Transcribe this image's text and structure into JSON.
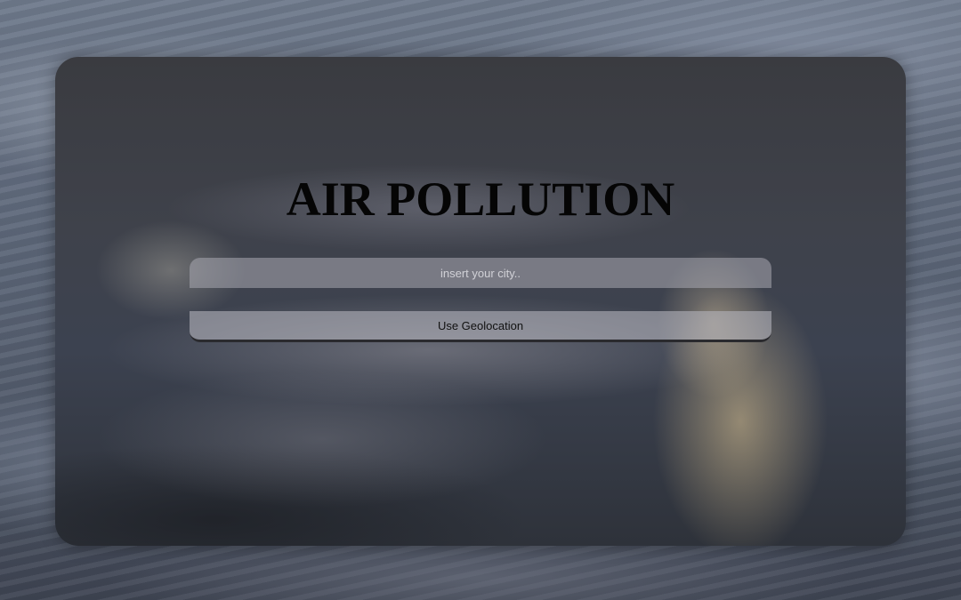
{
  "page": {
    "title": "AIR POLLUTION"
  },
  "search": {
    "placeholder": "insert your city..",
    "value": ""
  },
  "actions": {
    "geolocation_label": "Use Geolocation"
  }
}
